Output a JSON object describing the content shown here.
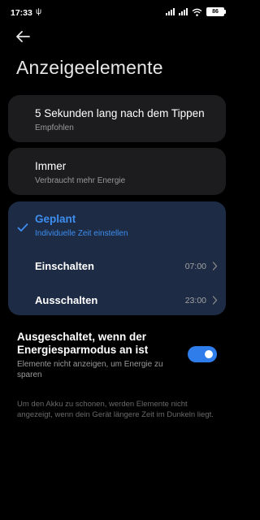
{
  "status_bar": {
    "time": "17:33",
    "usb_glyph": "ψ",
    "battery_level": "86",
    "icons": [
      "usb-icon",
      "signal-icon",
      "signal-icon",
      "wifi-icon",
      "battery-icon"
    ]
  },
  "header": {
    "back_icon": "back-arrow-icon",
    "title": "Anzeigeelemente"
  },
  "options": [
    {
      "title": "5 Sekunden lang nach dem Tippen",
      "subtitle": "Empfohlen",
      "selected": false
    },
    {
      "title": "Immer",
      "subtitle": "Verbraucht mehr Energie",
      "selected": false
    },
    {
      "title": "Geplant",
      "subtitle": "Individuelle Zeit einstellen",
      "selected": true
    }
  ],
  "schedule": {
    "on_label": "Einschalten",
    "on_time": "07:00",
    "off_label": "Ausschalten",
    "off_time": "23:00"
  },
  "power_saving": {
    "title": "Ausgeschaltet, wenn der Energiesparmodus an ist",
    "subtitle": "Elemente nicht anzeigen, um Energie zu sparen",
    "enabled": true
  },
  "footnote": "Um den Akku zu schonen, werden Elemente nicht angezeigt, wenn dein Gerät längere Zeit im Dunkeln liegt.",
  "colors": {
    "background": "#000000",
    "card": "#1c1c1e",
    "selected_card": "#1d2b45",
    "accent": "#3d8ef0",
    "toggle_on": "#2f7dea"
  }
}
